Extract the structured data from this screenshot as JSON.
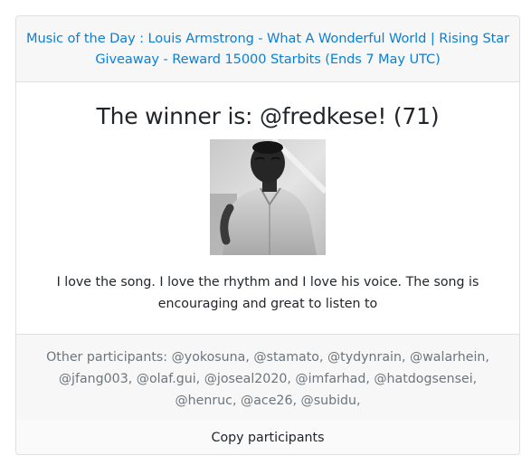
{
  "header": {
    "title_line1": "Music of the Day : Louis Armstrong - What A Wonderful World | Rising Star",
    "title_line2": "Giveaway - Reward 15000 Starbits (Ends 7 May UTC)"
  },
  "winner": {
    "heading": "The winner is: @fredkese! (71)",
    "comment": "I love the song. I love the rhythm and I love his voice. The song is encouraging and great to listen to"
  },
  "participants": {
    "label": "Other participants:",
    "names": [
      "@yokosuna,",
      "@stamato,",
      "@tydynrain,",
      "@walarhein,",
      "@jfang003,",
      "@olaf.gui,",
      "@joseal2020,",
      "@imfarhad,",
      "@hatdogsensei,",
      "@henruc,",
      "@ace26,",
      "@subidu,"
    ]
  },
  "actions": {
    "copy_label": "Copy participants"
  },
  "colors": {
    "link": "#0b7fd4",
    "muted_text": "#6c757d",
    "panel_bg": "#f7f7f7",
    "border": "#dfdfdf"
  }
}
